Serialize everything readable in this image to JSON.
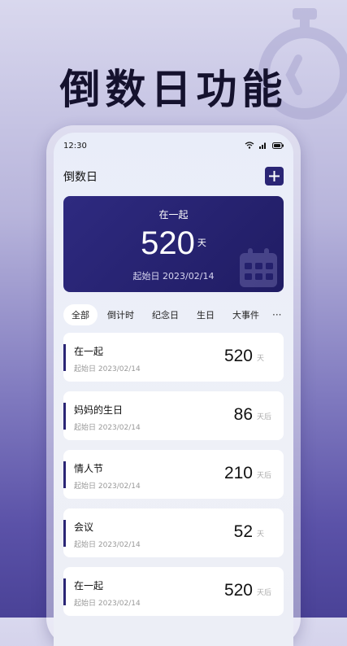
{
  "banner": {
    "title": "倒数日功能"
  },
  "status_bar": {
    "time": "12:30"
  },
  "app": {
    "title": "倒数日",
    "add_label": "+"
  },
  "hero_card": {
    "name": "在一起",
    "count": "520",
    "unit": "天",
    "start_label": "起始日 2023/02/14"
  },
  "tabs": [
    {
      "label": "全部",
      "active": true
    },
    {
      "label": "倒计时"
    },
    {
      "label": "纪念日"
    },
    {
      "label": "生日"
    },
    {
      "label": "大事件"
    }
  ],
  "tab_more": "···",
  "items": [
    {
      "title": "在一起",
      "sub": "起始日 2023/02/14",
      "count": "520",
      "unit": "天"
    },
    {
      "title": "妈妈的生日",
      "sub": "起始日 2023/02/14",
      "count": "86",
      "unit": "天后"
    },
    {
      "title": "情人节",
      "sub": "起始日 2023/02/14",
      "count": "210",
      "unit": "天后"
    },
    {
      "title": "会议",
      "sub": "起始日 2023/02/14",
      "count": "52",
      "unit": "天"
    },
    {
      "title": "在一起",
      "sub": "起始日 2023/02/14",
      "count": "520",
      "unit": "天后"
    }
  ],
  "colors": {
    "accent": "#2a2575",
    "card_bg": "#211d66"
  }
}
